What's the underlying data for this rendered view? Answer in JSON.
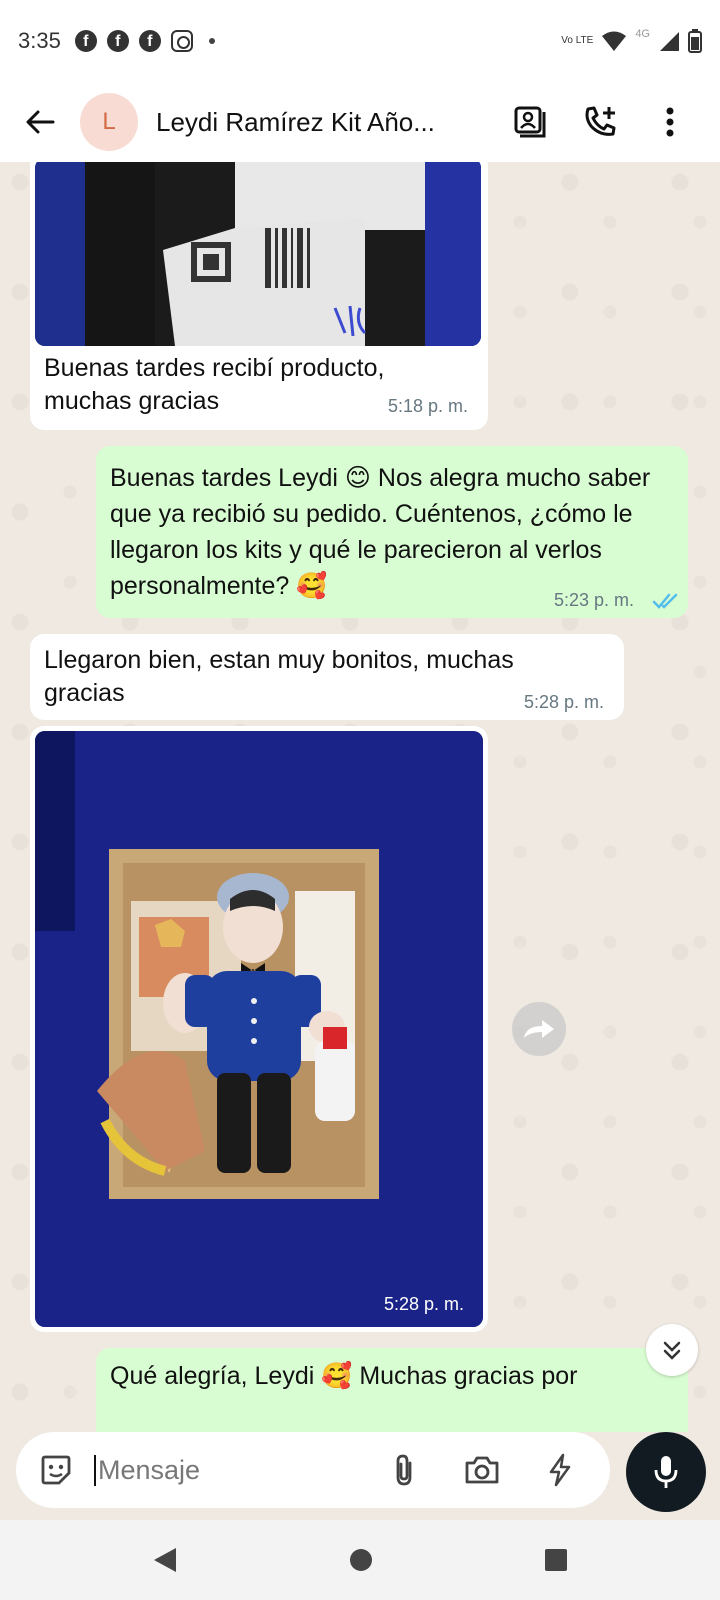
{
  "status_bar": {
    "time": "3:35",
    "network_label": "4G",
    "volte_label": "Vo LTE"
  },
  "header": {
    "avatar_letter": "L",
    "contact_name": "Leydi Ramírez Kit Año..."
  },
  "messages": [
    {
      "direction": "in",
      "type": "image_caption",
      "text": "Buenas tardes recibí producto, muchas gracias",
      "time": "5:18 p. m."
    },
    {
      "direction": "out",
      "type": "text",
      "text": "Buenas tardes Leydi 😊 Nos alegra mucho saber que ya recibió su pedido. Cuéntenos, ¿cómo le llegaron los kits y qué le parecieron al verlos personalmente? 🥰",
      "time": "5:23 p. m."
    },
    {
      "direction": "in",
      "type": "text",
      "text": "Llegaron bien, estan muy bonitos, muchas gracias",
      "time": "5:28 p. m."
    },
    {
      "direction": "in",
      "type": "image",
      "time": "5:28 p. m."
    },
    {
      "direction": "out",
      "type": "text",
      "text": "Qué alegría, Leydi 🥰 Muchas gracias por"
    }
  ],
  "composer": {
    "placeholder": "Mensaje"
  },
  "colors": {
    "outgoing_bubble": "#d9fdd3",
    "incoming_bubble": "#ffffff",
    "chat_background": "#efe9e1",
    "read_ticks": "#53bdeb"
  }
}
